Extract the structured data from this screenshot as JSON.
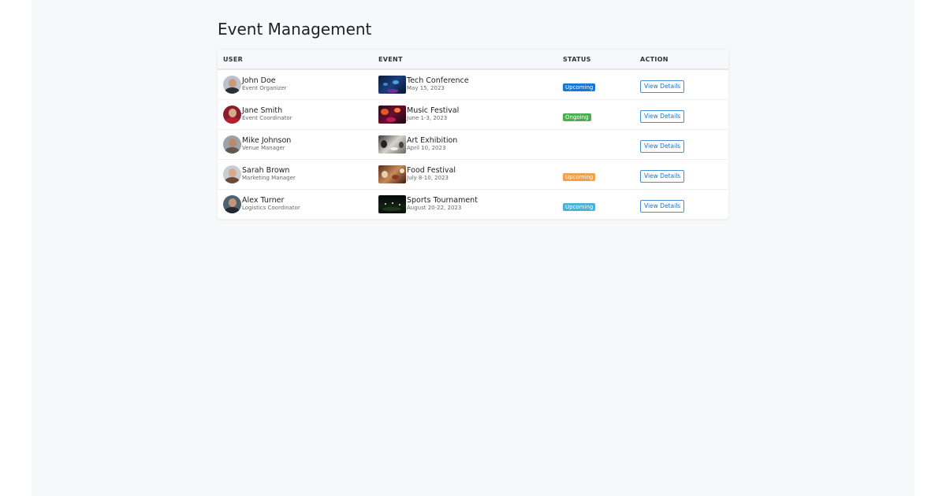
{
  "page": {
    "title": "Event Management"
  },
  "table": {
    "columns": [
      "USER",
      "EVENT",
      "STATUS",
      "ACTION"
    ],
    "rows": [
      {
        "user": {
          "name": "John Doe",
          "role": "Event Organizer"
        },
        "event": {
          "name": "Tech Conference",
          "date": "May 15, 2023"
        },
        "status": {
          "label": "Upcoming",
          "color": "#1976d2"
        },
        "action": "View Details"
      },
      {
        "user": {
          "name": "Jane Smith",
          "role": "Event Coordinator"
        },
        "event": {
          "name": "Music Festival",
          "date": "June 1-3, 2023"
        },
        "status": {
          "label": "Ongoing",
          "color": "#4caf50"
        },
        "action": "View Details"
      },
      {
        "user": {
          "name": "Mike Johnson",
          "role": "Venue Manager"
        },
        "event": {
          "name": "Art Exhibition",
          "date": "April 10, 2023"
        },
        "status": {
          "label": "",
          "color": ""
        },
        "action": "View Details"
      },
      {
        "user": {
          "name": "Sarah Brown",
          "role": "Marketing Manager"
        },
        "event": {
          "name": "Food Festival",
          "date": "July 8-10, 2023"
        },
        "status": {
          "label": "Upcoming",
          "color": "#f0a04b"
        },
        "action": "View Details"
      },
      {
        "user": {
          "name": "Alex Turner",
          "role": "Logistics Coordinator"
        },
        "event": {
          "name": "Sports Tournament",
          "date": "August 20-22, 2023"
        },
        "status": {
          "label": "Upcoming",
          "color": "#4ab3d4"
        },
        "action": "View Details"
      }
    ]
  }
}
